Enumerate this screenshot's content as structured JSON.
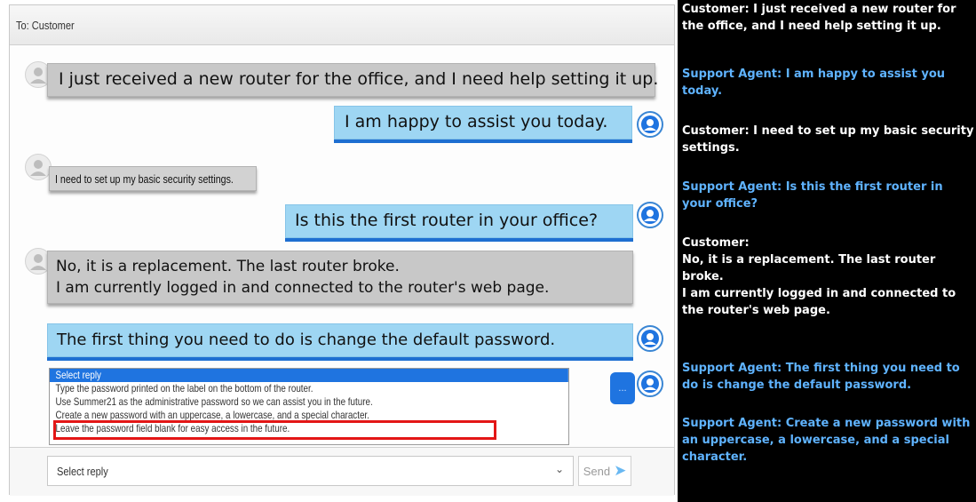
{
  "header": {
    "to_label": "To: Customer"
  },
  "messages": [
    {
      "sender": "customer",
      "text": "I just received a new router for the office, and I need help setting it up."
    },
    {
      "sender": "agent",
      "text": "I am happy to assist you today."
    },
    {
      "sender": "customer",
      "text": "I need to set up my basic security settings."
    },
    {
      "sender": "agent",
      "text": "Is this the first router in your office?"
    },
    {
      "sender": "customer",
      "line1": "No, it is a replacement. The last router broke.",
      "line2": "I am currently logged in and connected to the router's web page."
    },
    {
      "sender": "agent",
      "text": "The first thing you need to do is change the default password."
    }
  ],
  "typing_indicator": "...",
  "reply_dropdown": {
    "options": [
      "Select reply",
      "Type the password printed on the label on the bottom of the router.",
      "Use Summer21 as the administrative password so we can assist you in the future.",
      "Create a new password with an uppercase, a lowercase, and a special character.",
      "Leave the password field blank for easy access in the future."
    ],
    "selected_index": 0,
    "highlighted_index": 3
  },
  "composer": {
    "select_value": "Select reply",
    "send_label": "Send"
  },
  "transcript": [
    {
      "role": "customer",
      "text": "Customer: I just received a new router for the office, and I need help setting it up."
    },
    {
      "role": "agent",
      "text": "Support Agent: I am happy to assist you today."
    },
    {
      "role": "customer",
      "text": "Customer: I need to set up my basic security settings."
    },
    {
      "role": "agent",
      "text": "Support Agent: Is this the first router in your office?"
    },
    {
      "role": "customer",
      "text": "Customer:\nNo, it is a replacement. The last router broke.\nI am currently logged in and connected to the router's web page."
    },
    {
      "role": "agent",
      "text": "Support Agent: The first thing you need to do is change the default password."
    },
    {
      "role": "agent",
      "text": "Support Agent: Create a new password with an uppercase, a lowercase, and a special character."
    }
  ],
  "colors": {
    "agent_bubble": "#9ed6f3",
    "customer_bubble": "#c8c8c8",
    "selection_blue": "#1f74e0",
    "highlight_red": "#e31616",
    "transcript_agent_text": "#5fb3ff"
  },
  "icons": {
    "customer_avatar": "person-icon",
    "agent_avatar": "headset-agent-icon",
    "send_arrow": "arrow-right-icon",
    "dropdown": "chevron-down-icon"
  }
}
